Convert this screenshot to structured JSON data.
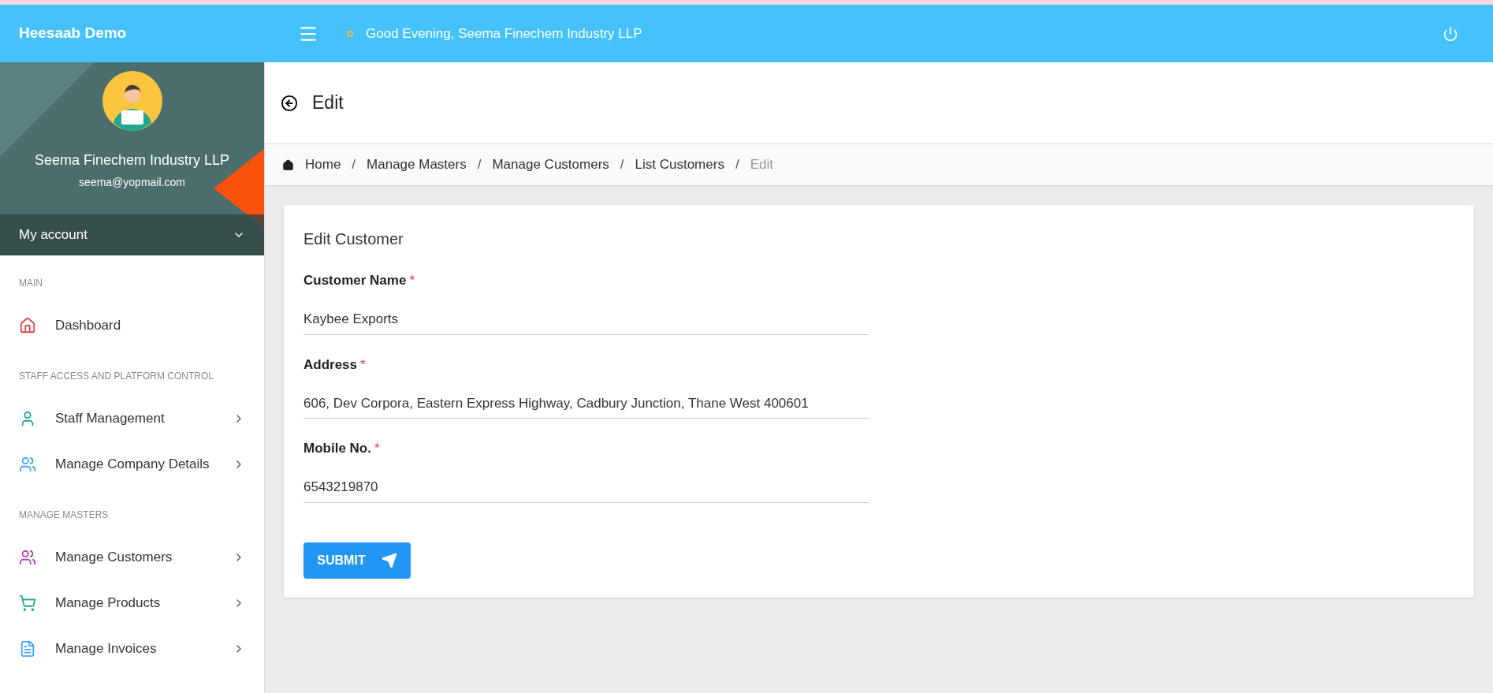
{
  "topbar": {
    "brand": "Heesaab Demo",
    "greeting": "Good Evening, Seema Finechem Industry LLP"
  },
  "profile": {
    "name": "Seema Finechem Industry LLP",
    "email": "seema@yopmail.com",
    "account_label": "My account"
  },
  "sidebar": {
    "sections": [
      {
        "title": "MAIN",
        "items": [
          {
            "label": "Dashboard",
            "color": "#e0454f",
            "has_submenu": false
          }
        ]
      },
      {
        "title": "STAFF ACCESS AND PLATFORM CONTROL",
        "items": [
          {
            "label": "Staff Management",
            "color": "#26a69a",
            "has_submenu": true
          },
          {
            "label": "Manage Company Details",
            "color": "#42a5f5",
            "has_submenu": true
          }
        ]
      },
      {
        "title": "MANAGE MASTERS",
        "items": [
          {
            "label": "Manage Customers",
            "color": "#ab47bc",
            "has_submenu": true
          },
          {
            "label": "Manage Products",
            "color": "#26a69a",
            "has_submenu": true
          },
          {
            "label": "Manage Invoices",
            "color": "#42a5f5",
            "has_submenu": true
          }
        ]
      }
    ]
  },
  "page": {
    "title": "Edit"
  },
  "breadcrumb": [
    {
      "label": "Home",
      "current": false
    },
    {
      "separator": "/",
      "label": "Manage Masters",
      "current": false
    },
    {
      "separator": "/",
      "label": "Manage Customers",
      "current": false
    },
    {
      "separator": "/",
      "label": "List Customers",
      "current": false
    },
    {
      "separator": "/",
      "label": "Edit",
      "current": true
    }
  ],
  "form": {
    "title": "Edit Customer",
    "fields": [
      {
        "label": "Customer Name",
        "required_mark": "*",
        "value": "Kaybee Exports"
      },
      {
        "label": "Address",
        "required_mark": "*",
        "value": "606, Dev Corpora, Eastern Express Highway, Cadbury Junction, Thane West 400601"
      },
      {
        "label": "Mobile No.",
        "required_mark": "*",
        "value": "6543219870"
      }
    ],
    "submit": "SUBMIT"
  }
}
